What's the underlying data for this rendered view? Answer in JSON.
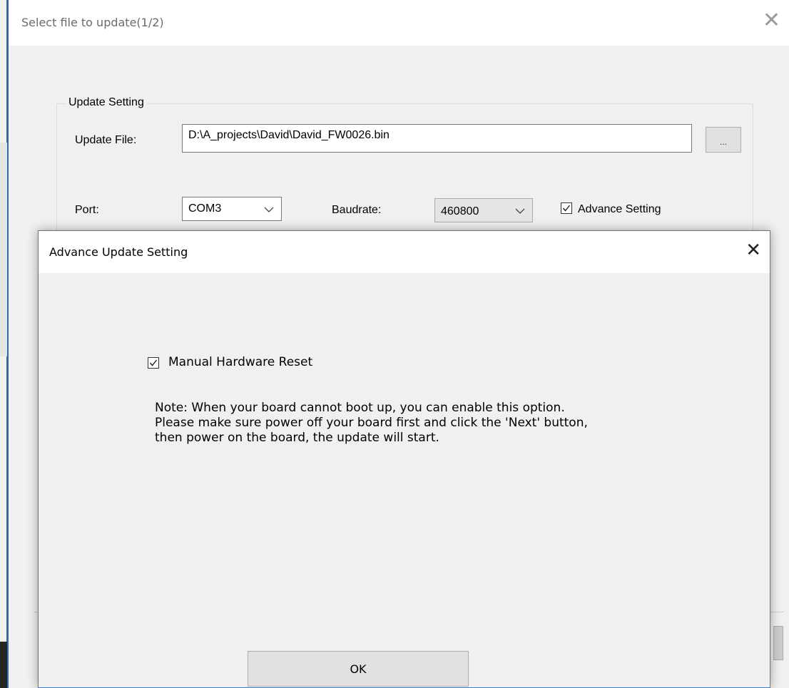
{
  "main_window": {
    "title": "Select file to update(1/2)",
    "close_glyph": "✕",
    "update_setting": {
      "group_label": "Update Setting",
      "update_file_label": "Update File:",
      "update_file_value": "D:\\A_projects\\David\\David_FW0026.bin",
      "browse_label": "...",
      "port_label": "Port:",
      "port_value": "COM3",
      "baudrate_label": "Baudrate:",
      "baudrate_value": "460800",
      "advance_setting_label": "Advance Setting",
      "advance_setting_checked": true
    }
  },
  "modal": {
    "title": "Advance Update Setting",
    "close_glyph": "✕",
    "manual_reset_label": "Manual Hardware Reset",
    "manual_reset_checked": true,
    "note_lines": [
      "Note: When your board cannot boot up, you can enable this option.",
      "Please make sure power off your board first and click the 'Next' button,",
      "then power on the board, the update will start."
    ],
    "ok_label": "OK"
  },
  "icons": {
    "dropdown_arrow": "chevron-down-icon",
    "check": "check-icon",
    "close": "close-icon"
  },
  "colors": {
    "accent": "#3d7fc4",
    "title_text": "#6a6a6a"
  }
}
